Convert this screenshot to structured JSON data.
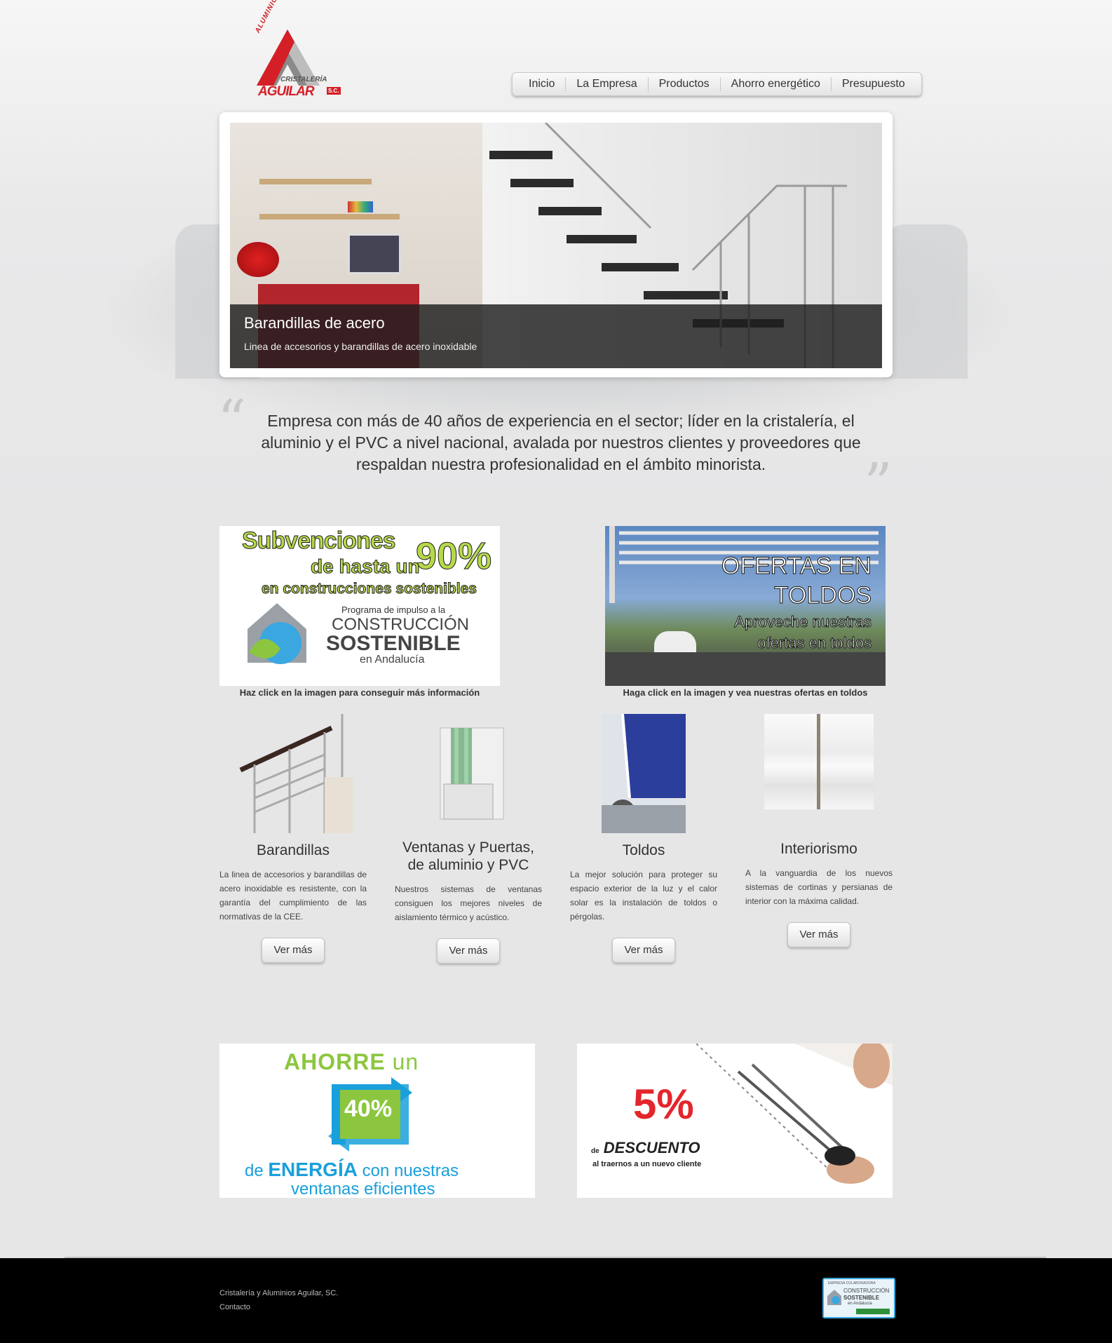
{
  "brand": {
    "logo_lines": [
      "ALUMINIOS",
      "CRISTALERÍA",
      "AGUILAR",
      "S.C."
    ]
  },
  "nav": {
    "items": [
      "Inicio",
      "La Empresa",
      "Productos",
      "Ahorro energético",
      "Presupuesto"
    ]
  },
  "slider": {
    "title": "Barandillas de acero",
    "subtitle": "Linea de accesorios y barandillas de acero inoxidable"
  },
  "quote": {
    "text": "Empresa con más de 40 años de experiencia en el sector; líder en la cristalería, el aluminio y el PVC a nivel nacional, avalada por nuestros clientes y proveedores que respaldan nuestra profesionalidad en el ámbito minorista.",
    "open_mark": "“",
    "close_mark": "”"
  },
  "promos": [
    {
      "lines": [
        "Subvenciones",
        "de hasta un",
        "90%",
        "en construcciones sostenibles"
      ],
      "program_lines": [
        "Programa de impulso a la",
        "CONSTRUCCIÓN",
        "SOSTENIBLE",
        "en Andalucía"
      ],
      "caption": "Haz click en la imagen para conseguir más información"
    },
    {
      "lines": [
        "OFERTAS EN",
        "TOLDOS",
        "Aproveche nuestras",
        "ofertas en toldos"
      ],
      "caption": "Haga click en la imagen y vea nuestras ofertas en toldos"
    }
  ],
  "products": [
    {
      "title": "Barandillas",
      "desc": "La linea de accesorios y barandillas de acero inoxidable es resistente, con la garantía del cumplimiento de las normativas de la CEE.",
      "button": "Ver más"
    },
    {
      "title": "Ventanas y Puertas, de aluminio y PVC",
      "desc": "Nuestros sistemas de ventanas consiguen los mejores niveles de aislamiento térmico y acústico.",
      "button": "Ver más"
    },
    {
      "title": "Toldos",
      "desc": "La mejor solución para proteger su espacio exterior de la luz y el calor solar es la instalación de toldos o pérgolas.",
      "button": "Ver más"
    },
    {
      "title": "Interiorismo",
      "desc": "A la vanguardia de los nuevos sistemas de cortinas y persianas de interior con la máxima calidad.",
      "button": "Ver más"
    }
  ],
  "banners": {
    "energy": {
      "line1a": "AHORRE",
      "line1b": "un",
      "percent": "40%",
      "line3a": "de",
      "line3b": "ENERGÍA",
      "line3c": "con nuestras",
      "line4": "ventanas eficientes"
    },
    "discount": {
      "percent": "5%",
      "de": "de",
      "word": "DESCUENTO",
      "sub": "al traernos a un nuevo cliente"
    }
  },
  "footer": {
    "company": "Cristalería y Aluminios Aguilar, SC.",
    "contact": "Contacto",
    "badge_lines": [
      "EMPRESA COLABORADORA",
      "CONSTRUCCIÓN",
      "SOSTENIBLE",
      "en Andalucía"
    ]
  },
  "colors": {
    "brand_red": "#d51f26",
    "promo_green": "#8cc63f",
    "energy_blue": "#1aa0db",
    "discount_red": "#e3262c"
  }
}
